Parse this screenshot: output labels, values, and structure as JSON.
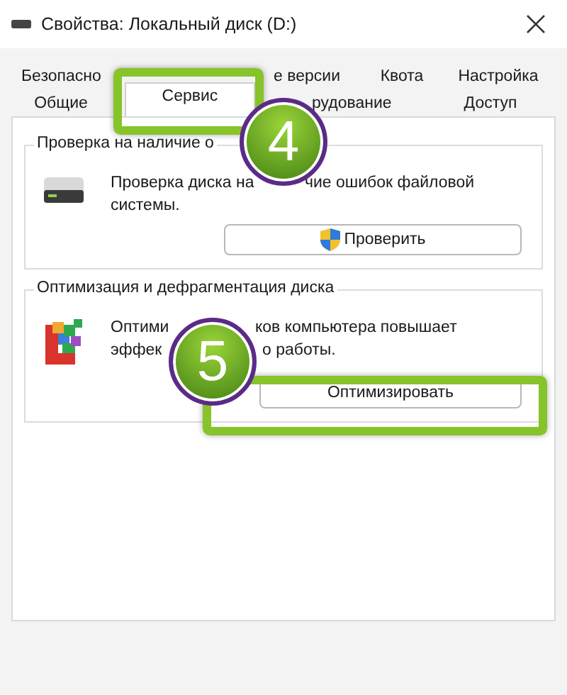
{
  "window": {
    "title": "Свойства: Локальный диск (D:)"
  },
  "tab_rows": [
    [
      {
        "label": "Безопасно",
        "selected": false
      },
      {
        "label": "е версии",
        "selected": false
      },
      {
        "label": "Квота",
        "selected": false
      },
      {
        "label": "Настройка",
        "selected": false
      }
    ],
    [
      {
        "label": "Общие",
        "selected": false
      },
      {
        "label": "Сервис",
        "selected": true
      },
      {
        "label": "рудование",
        "selected": false
      },
      {
        "label": "Доступ",
        "selected": false
      }
    ]
  ],
  "groups": [
    {
      "kind": "check",
      "title": "Проверка на наличие о",
      "lines": [
        [
          "Проверка диска на",
          "чие ошибок файловой"
        ],
        [
          "системы."
        ]
      ],
      "button": "Проверить"
    },
    {
      "kind": "optimize",
      "title": "Оптимизация и дефрагментация диска",
      "lines": [
        [
          "Оптими",
          "ков компьютера повышает"
        ],
        [
          "эффек",
          "о работы."
        ]
      ],
      "button": "Оптимизировать"
    }
  ],
  "annotations": [
    {
      "kind": "frame"
    },
    {
      "kind": "badge",
      "label": "4"
    },
    {
      "kind": "frame"
    },
    {
      "kind": "badge",
      "label": "5"
    }
  ]
}
